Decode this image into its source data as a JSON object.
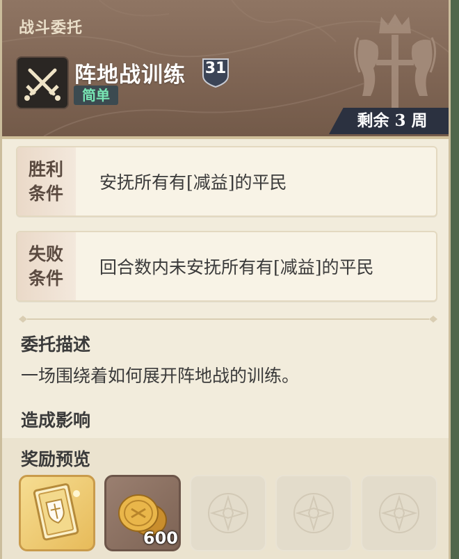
{
  "header": {
    "category": "战斗委托",
    "title": "阵地战训练",
    "level": "31",
    "difficulty": "简单",
    "remaining": "剩余 3 周",
    "emblem_icon": "crossed-swords-icon",
    "crest_icon": "royal-crest-icon"
  },
  "conditions": {
    "victory": {
      "tag": "胜利条件",
      "text": "安抚所有有[减益]的平民"
    },
    "defeat": {
      "tag": "失败条件",
      "text": "回合数内未安抚所有有[减益]的平民"
    }
  },
  "description": {
    "title": "委托描述",
    "text": "一场围绕着如何展开阵地战的训练。"
  },
  "impact": {
    "title": "造成影响"
  },
  "rewards": {
    "title": "奖励预览",
    "items": [
      {
        "icon": "shield-book-icon"
      },
      {
        "icon": "gold-coins-icon",
        "count": "600"
      },
      {
        "icon": "empty-slot-icon"
      },
      {
        "icon": "empty-slot-icon"
      },
      {
        "icon": "empty-slot-icon"
      }
    ]
  },
  "colors": {
    "header_bg": "#7f6554",
    "panel_bg": "#f2ecdc",
    "difficulty_text": "#78e6b4",
    "badge_bg": "#2b3140"
  }
}
